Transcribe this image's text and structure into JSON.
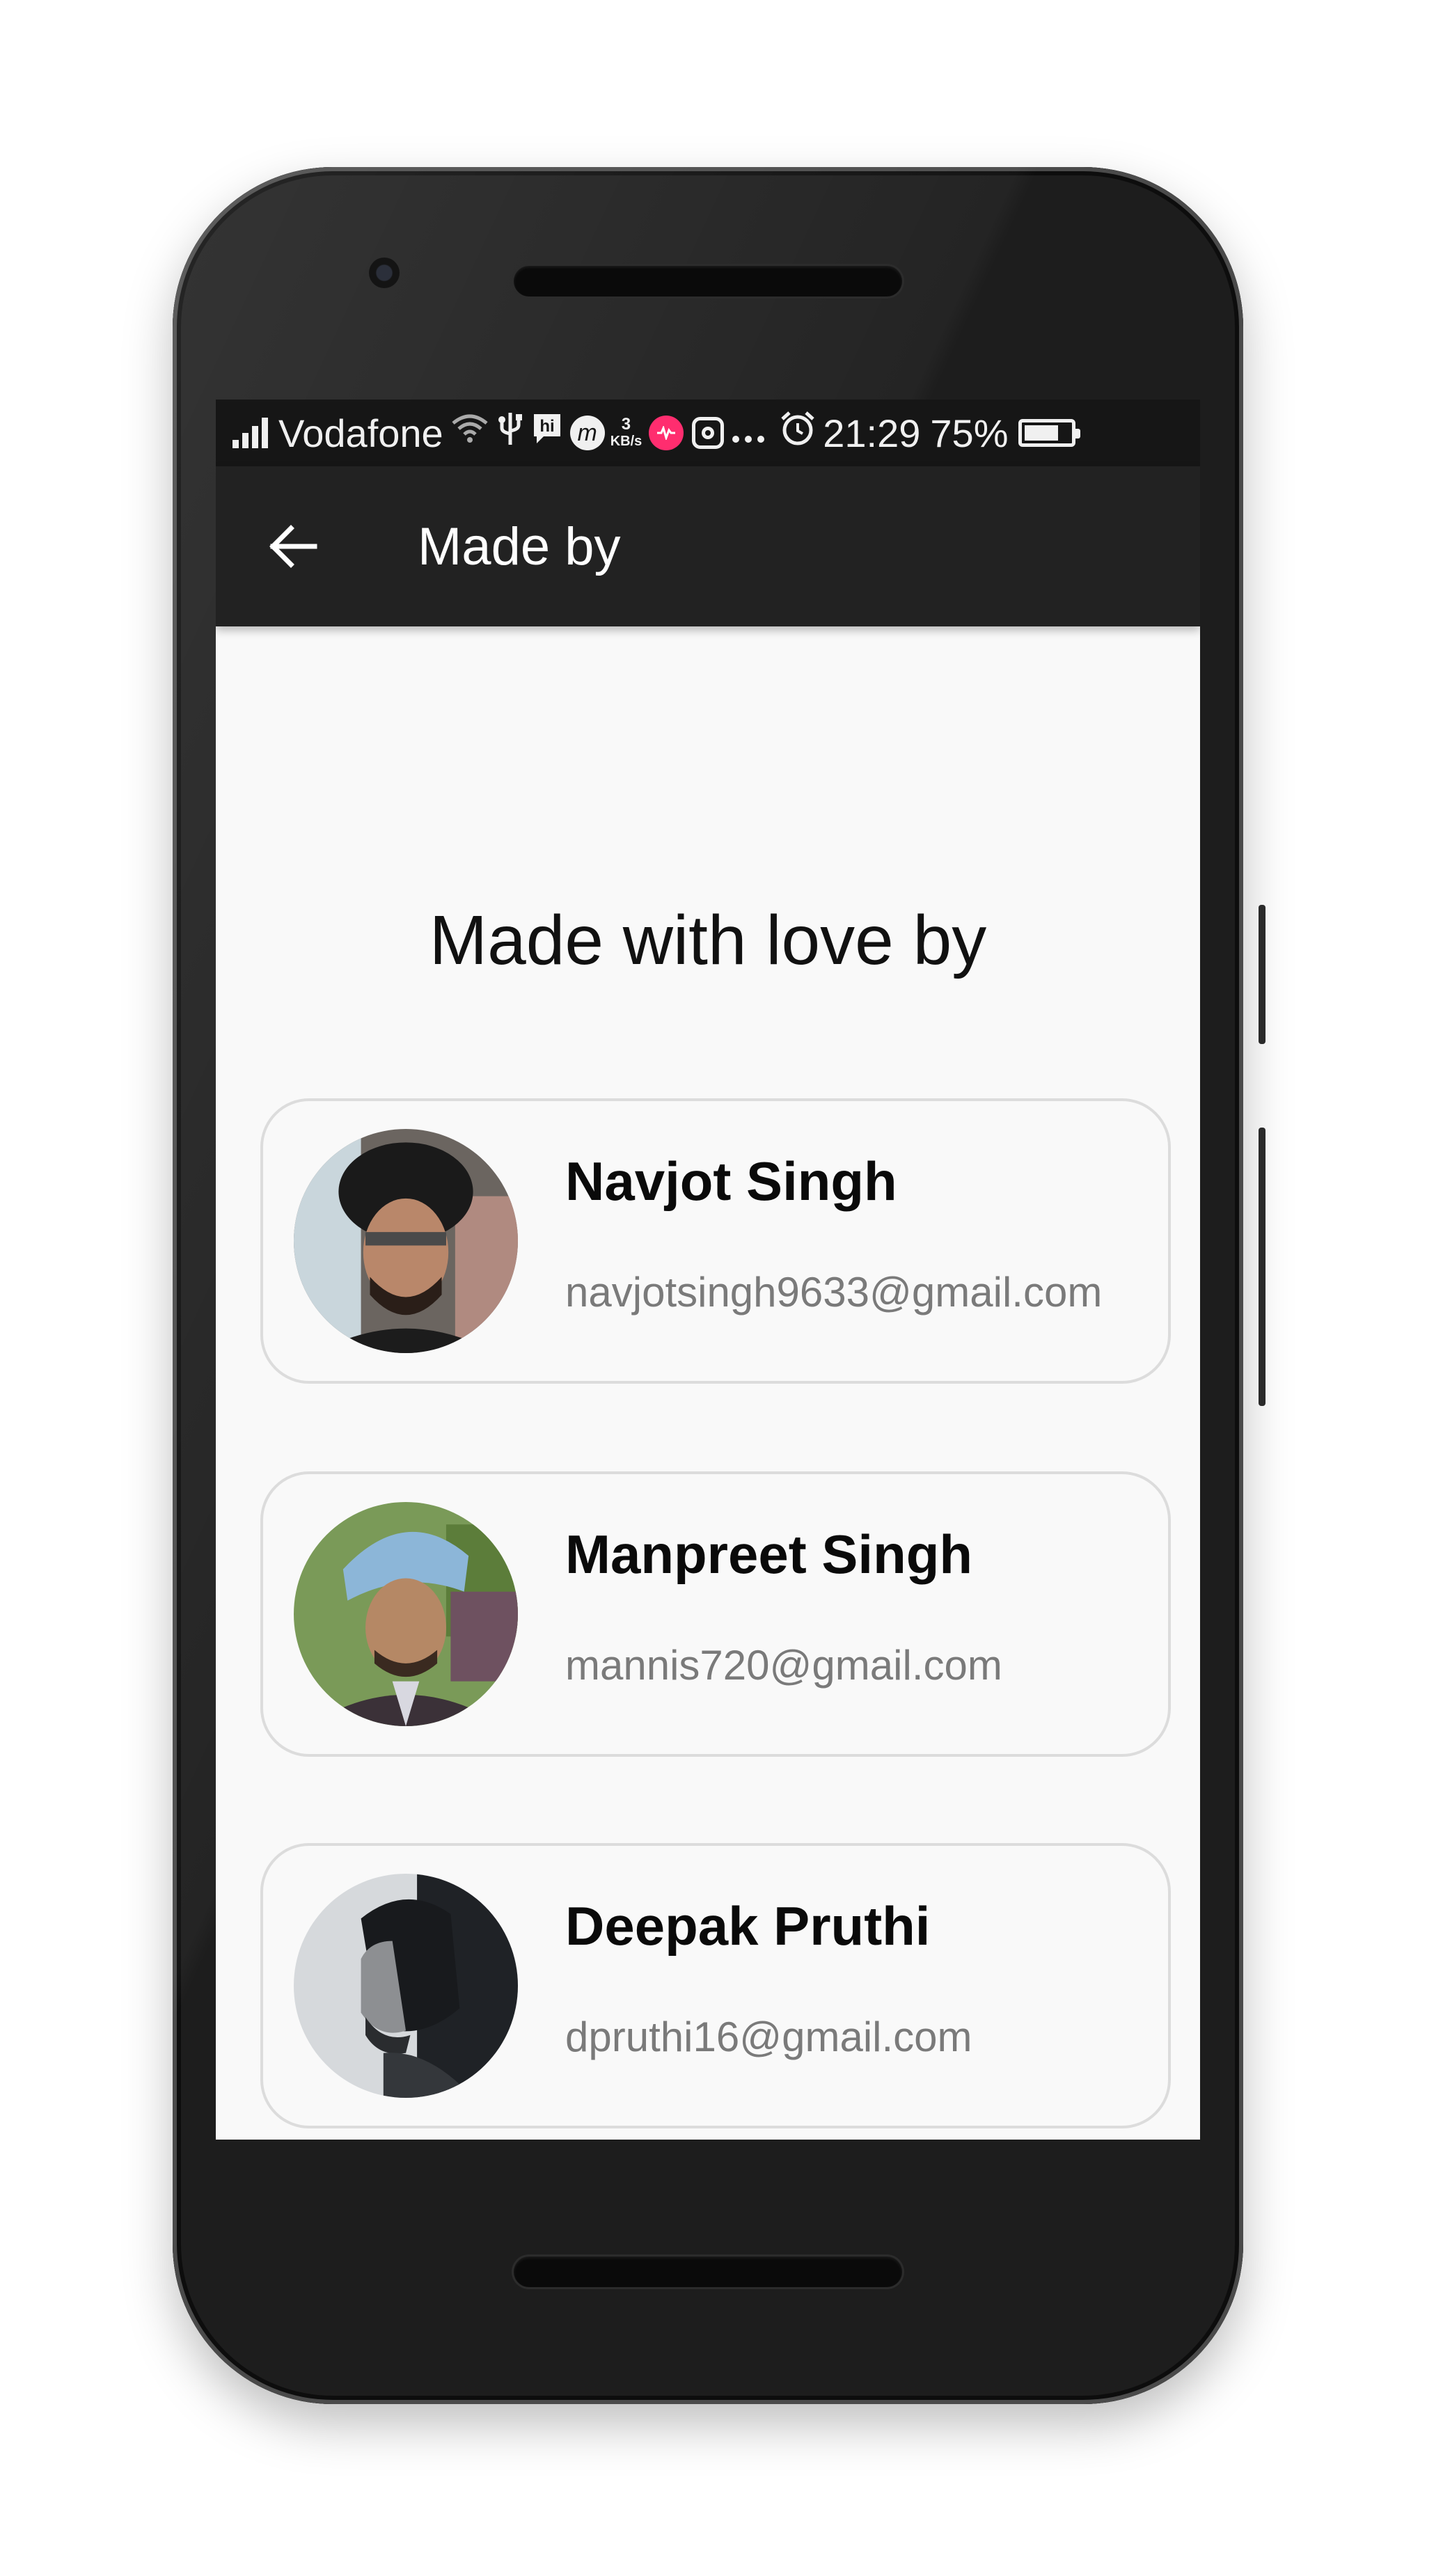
{
  "status_bar": {
    "carrier": "Vodafone",
    "network_speed_value": "3",
    "network_speed_unit": "KB/s",
    "time": "21:29",
    "battery_percent": "75%",
    "battery_level": 0.75,
    "icons": [
      "signal-icon",
      "wifi-icon",
      "usb-icon",
      "hike-icon",
      "messenger-icon",
      "musically-icon",
      "instagram-icon",
      "more-icon",
      "alarm-icon",
      "battery-icon"
    ]
  },
  "appbar": {
    "back_icon": "arrow-left-icon",
    "title": "Made by"
  },
  "main": {
    "heading": "Made with love by",
    "people": [
      {
        "name": "Navjot Singh",
        "email": "navjotsingh9633@gmail.com"
      },
      {
        "name": "Manpreet Singh",
        "email": "mannis720@gmail.com"
      },
      {
        "name": "Deepak Pruthi",
        "email": "dpruthi16@gmail.com"
      }
    ]
  },
  "colors": {
    "appbar": "#222222",
    "statusbar": "#161616",
    "screen_bg": "#f9f9f9",
    "card_border": "#dcdcdc",
    "email_text": "#7a7a7a"
  }
}
